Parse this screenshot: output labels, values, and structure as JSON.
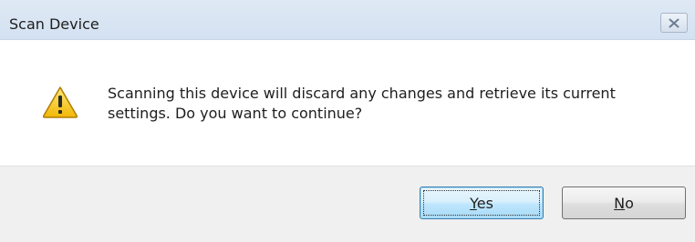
{
  "dialog": {
    "title": "Scan Device",
    "message": "Scanning this device will discard any changes and retrieve its current settings.  Do you want to continue?",
    "icon": "warning-icon",
    "close_icon": "close-icon"
  },
  "buttons": {
    "yes": {
      "mnemonic": "Y",
      "rest": "es"
    },
    "no": {
      "mnemonic": "N",
      "rest": "o"
    }
  },
  "colors": {
    "warning_fill": "#f5c518",
    "default_button_border": "#3c7fb1"
  }
}
